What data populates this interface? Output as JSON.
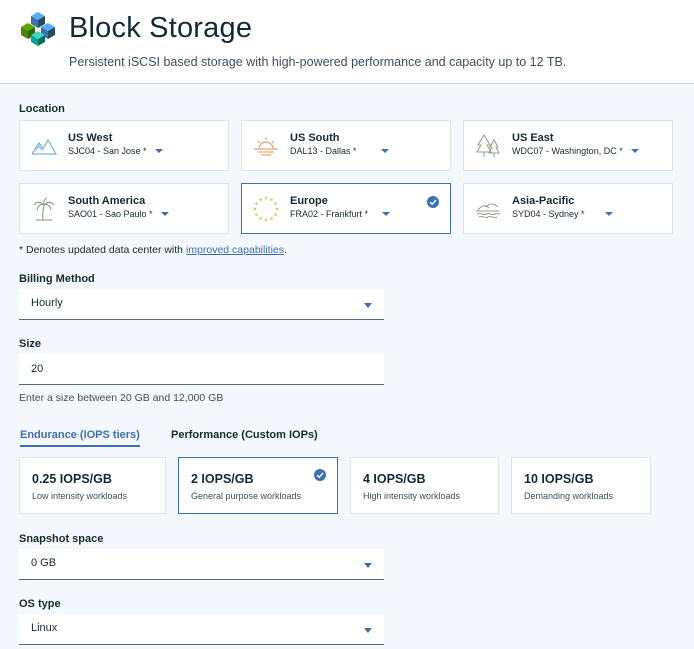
{
  "header": {
    "title": "Block Storage",
    "subtitle": "Persistent iSCSI based storage with high-powered performance and capacity up to 12 TB."
  },
  "location": {
    "label": "Location",
    "cards": [
      {
        "name": "US West",
        "datacenter": "SJC04 - San Jose *",
        "icon": "mountain-icon",
        "selected": false
      },
      {
        "name": "US South",
        "datacenter": "DAL13 - Dallas *",
        "icon": "sun-icon",
        "selected": false
      },
      {
        "name": "US East",
        "datacenter": "WDC07 - Washington, DC *",
        "icon": "tree-icon",
        "selected": false
      },
      {
        "name": "South America",
        "datacenter": "SAO01 - Sao Paulo *",
        "icon": "palm-tree-icon",
        "selected": false
      },
      {
        "name": "Europe",
        "datacenter": "FRA02 - Frankfurt *",
        "icon": "stars-circle-icon",
        "selected": true
      },
      {
        "name": "Asia-Pacific",
        "datacenter": "SYD04 - Sydney *",
        "icon": "waves-icon",
        "selected": false
      }
    ],
    "note_prefix": "* Denotes updated data center with ",
    "note_link": "improved capabilities",
    "note_suffix": "."
  },
  "billing": {
    "label": "Billing Method",
    "value": "Hourly"
  },
  "size": {
    "label": "Size",
    "value": "20",
    "helper": "Enter a size between 20 GB and 12,000 GB"
  },
  "tabs": [
    {
      "label": "Endurance (IOPS tiers)",
      "active": true
    },
    {
      "label": "Performance (Custom IOPs)",
      "active": false
    }
  ],
  "tiers": [
    {
      "name": "0.25 IOPS/GB",
      "desc": "Low intensity workloads",
      "selected": false
    },
    {
      "name": "2 IOPS/GB",
      "desc": "General purpose workloads",
      "selected": true
    },
    {
      "name": "4 IOPS/GB",
      "desc": "High intensity workloads",
      "selected": false
    },
    {
      "name": "10 IOPS/GB",
      "desc": "Demanding workloads",
      "selected": false
    }
  ],
  "snapshot": {
    "label": "Snapshot space",
    "value": "0 GB"
  },
  "os": {
    "label": "OS type",
    "value": "Linux"
  },
  "colors": {
    "accent": "#3d70b2",
    "text": "#152935",
    "background": "#f4f7fb",
    "icon_green": "#8fa68a",
    "icon_orange": "#e8a36a",
    "icon_blue": "#7bb0d8"
  }
}
